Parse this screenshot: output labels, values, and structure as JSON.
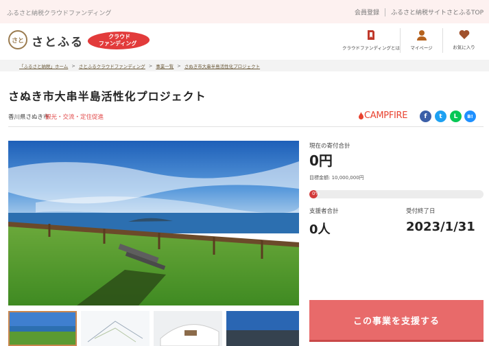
{
  "topbar": {
    "tagline": "ふるさと納税クラウドファンディング",
    "links": [
      "会員登録",
      "ふるさと納税サイトさとふるTOP"
    ]
  },
  "header": {
    "logo_mark": "さと",
    "logo_text": "さとふる",
    "badge_line1": "クラウド",
    "badge_line2": "ファンディング",
    "nav": [
      {
        "label": "クラウドファンディングとは",
        "icon": "book-icon"
      },
      {
        "label": "マイページ",
        "icon": "user-icon"
      },
      {
        "label": "お気に入り",
        "icon": "heart-icon"
      }
    ]
  },
  "breadcrumb": {
    "items": [
      "「ふるさと納税」ホーム",
      "さとふるクラウドファンディング",
      "事業一覧",
      "さぬき市大串半島活性化プロジェクト"
    ],
    "separator": ">"
  },
  "project": {
    "title": "さぬき市大串半島活性化プロジェクト",
    "region": "香川県さぬき市",
    "category": "観光・交流・定住促進",
    "partner": "CAMPFIRE"
  },
  "share": {
    "facebook": "f",
    "twitter": "t",
    "line": "L",
    "hatena": "B!"
  },
  "stats": {
    "current_label": "現在の寄付合計",
    "current_value": "0円",
    "goal_text": "目標金額: 10,000,000円",
    "progress_label": "0%",
    "progress_fraction": 0,
    "supporters_label": "支援者合計",
    "supporters_value": "0人",
    "deadline_label": "受付終了日",
    "deadline_value": "2023/1/31"
  },
  "cta": {
    "label": "この事業を支援する"
  },
  "colors": {
    "brand_red": "#e23b3b",
    "cta": "#e86a6a",
    "campfire": "#e8422f"
  }
}
